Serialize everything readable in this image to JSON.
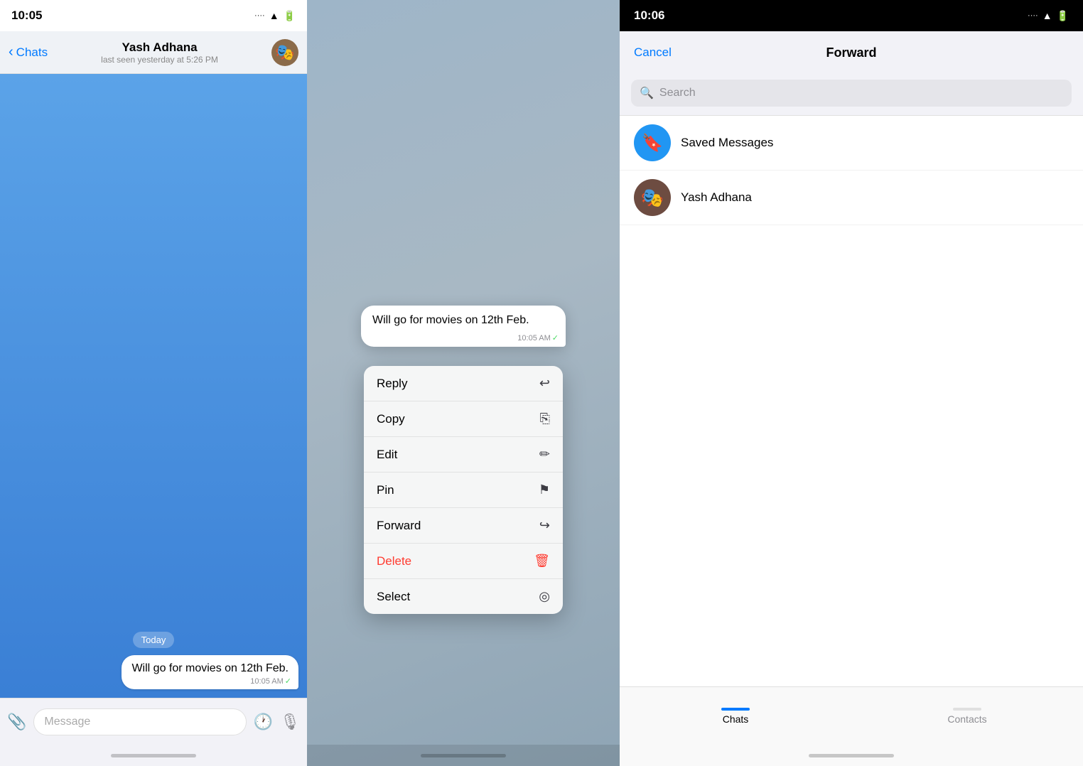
{
  "panel1": {
    "status_time": "10:05",
    "nav_name": "Yash Adhana",
    "nav_status": "last seen yesterday at 5:26 PM",
    "back_label": "Chats",
    "date_badge": "Today",
    "message_text": "Will go for movies on 12th Feb.",
    "message_time": "10:05 AM",
    "input_placeholder": "Message",
    "home_indicator": true
  },
  "panel2": {
    "message_text": "Will go for movies on 12th Feb.",
    "message_time": "10:05 AM",
    "menu_items": [
      {
        "label": "Reply",
        "icon": "↩",
        "style": "normal"
      },
      {
        "label": "Copy",
        "icon": "⎘",
        "style": "normal"
      },
      {
        "label": "Edit",
        "icon": "✏",
        "style": "normal"
      },
      {
        "label": "Pin",
        "icon": "📌",
        "style": "normal"
      },
      {
        "label": "Forward",
        "icon": "↪",
        "style": "normal"
      },
      {
        "label": "Delete",
        "icon": "🗑",
        "style": "delete"
      },
      {
        "label": "Select",
        "icon": "◎",
        "style": "normal"
      }
    ]
  },
  "panel3": {
    "status_time": "10:06",
    "cancel_label": "Cancel",
    "title": "Forward",
    "search_placeholder": "Search",
    "contacts": [
      {
        "name": "Saved Messages",
        "type": "saved"
      },
      {
        "name": "Yash Adhana",
        "type": "avatar"
      }
    ],
    "tabs": [
      {
        "label": "Chats",
        "active": true
      },
      {
        "label": "Contacts",
        "active": false
      }
    ]
  }
}
